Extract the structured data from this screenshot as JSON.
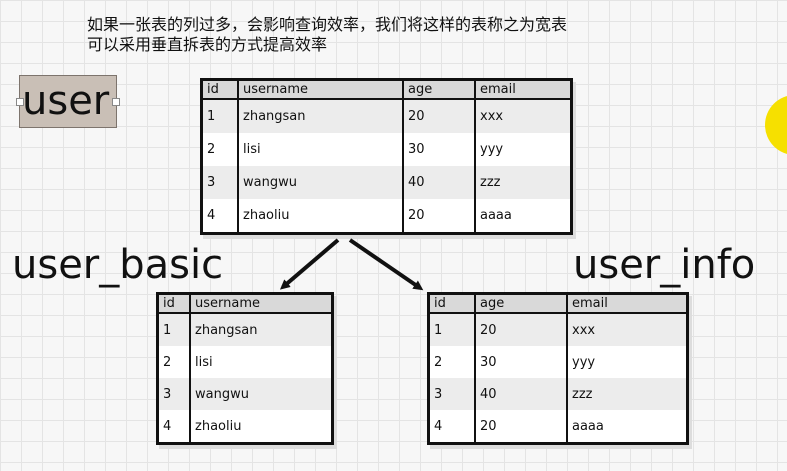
{
  "notes": {
    "line1": "如果一张表的列过多，会影响查询效率，我们将这样的表称之为宽表",
    "line2": "可以采用垂直拆表的方式提高效率"
  },
  "source_label": "user",
  "basic_label": "user_basic",
  "info_label": "user_info",
  "main_table": {
    "columns": [
      "id",
      "username",
      "age",
      "email"
    ],
    "rows": [
      [
        "1",
        "zhangsan",
        "20",
        "xxx"
      ],
      [
        "2",
        "lisi",
        "30",
        "yyy"
      ],
      [
        "3",
        "wangwu",
        "40",
        "zzz"
      ],
      [
        "4",
        "zhaoliu",
        "20",
        "aaaa"
      ]
    ]
  },
  "basic_table": {
    "columns": [
      "id",
      "username"
    ],
    "rows": [
      [
        "1",
        "zhangsan"
      ],
      [
        "2",
        "lisi"
      ],
      [
        "3",
        "wangwu"
      ],
      [
        "4",
        "zhaoliu"
      ]
    ]
  },
  "info_table": {
    "columns": [
      "id",
      "age",
      "email"
    ],
    "rows": [
      [
        "1",
        "20",
        "xxx"
      ],
      [
        "2",
        "30",
        "yyy"
      ],
      [
        "3",
        "40",
        "zzz"
      ],
      [
        "4",
        "20",
        "aaaa"
      ]
    ]
  },
  "colors": {
    "accent_circle": "#f6e000",
    "label_fill": "#c9bfb6"
  }
}
